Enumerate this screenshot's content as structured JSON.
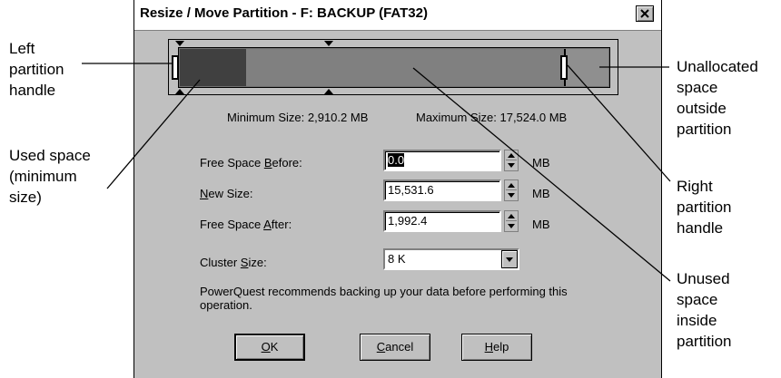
{
  "dialog": {
    "title": "Resize / Move Partition - F: BACKUP (FAT32)",
    "close_label": "close",
    "min_size_label": "Minimum Size:",
    "min_size_value": "2,910.2 MB",
    "max_size_label": "Maximum Size:",
    "max_size_value": "17,524.0 MB",
    "fields": [
      {
        "label_pre": "Free Space ",
        "label_key": "B",
        "label_post": "efore:",
        "value": "0.0",
        "unit": "MB"
      },
      {
        "label_pre": "",
        "label_key": "N",
        "label_post": "ew Size:",
        "value": "15,531.6",
        "unit": "MB"
      },
      {
        "label_pre": "Free Space ",
        "label_key": "A",
        "label_post": "fter:",
        "value": "1,992.4",
        "unit": "MB"
      }
    ],
    "cluster": {
      "label_pre": "Cluster ",
      "label_key": "S",
      "label_post": "ize:",
      "value": "8 K"
    },
    "note": "PowerQuest recommends backing up your data before performing this operation.",
    "buttons": {
      "ok": {
        "key": "O",
        "rest": "K"
      },
      "cancel": {
        "key": "C",
        "rest": "ancel"
      },
      "help": {
        "key": "H",
        "rest": "elp"
      }
    },
    "map": {
      "used_fraction": 0.155,
      "partition_fraction": 0.896
    }
  },
  "callouts": {
    "left_handle": [
      "Left",
      "partition",
      "handle"
    ],
    "used_space": [
      "Used space",
      "(minimum",
      "size)"
    ],
    "unallocated": [
      "Unallocated",
      "space",
      "outside",
      "partition"
    ],
    "right_handle": [
      "Right",
      "partition",
      "handle"
    ],
    "unused": [
      "Unused",
      "space",
      "inside",
      "partition"
    ]
  },
  "icons": {
    "close": "close-icon",
    "spin_up": "spin-up-icon",
    "spin_down": "spin-down-icon",
    "dropdown": "chevron-down-icon"
  }
}
